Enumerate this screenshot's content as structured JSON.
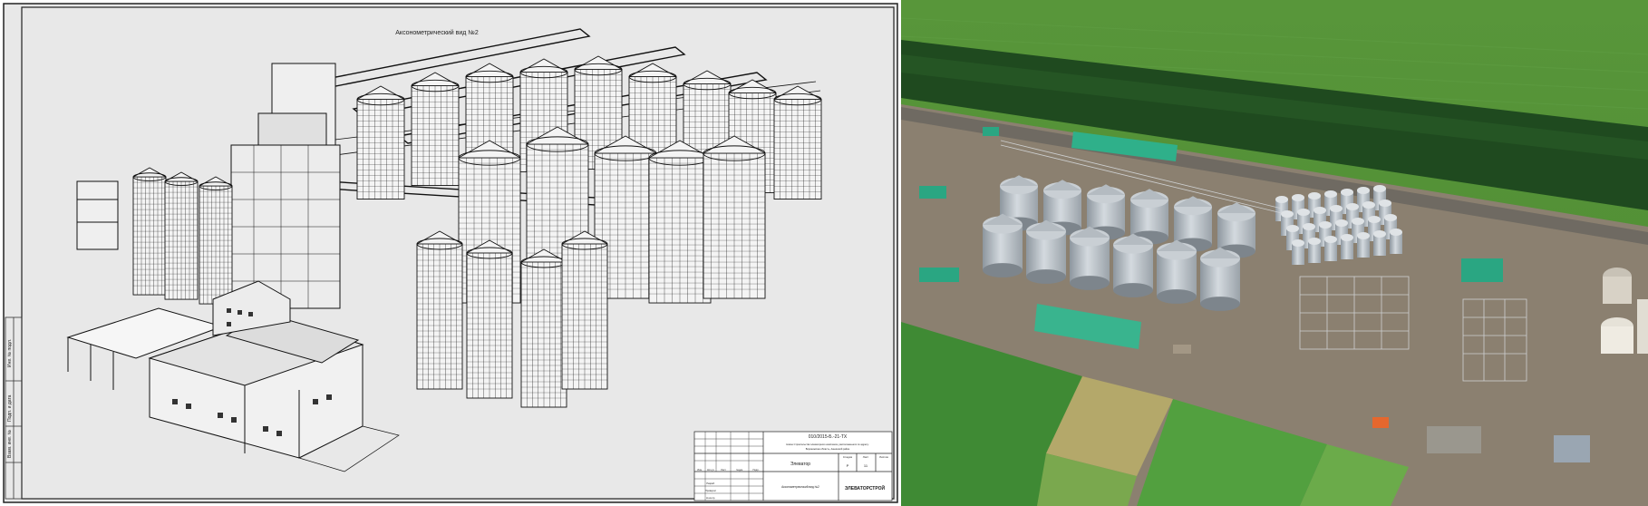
{
  "drawing": {
    "title": "Аксонометрический вид №2",
    "stamp": {
      "doc_code": "010/2015-Б.-21-ТХ",
      "project_line_1": "Новое Строительство элеваторного комплекса, расположенного по адресу:",
      "project_line_2": "Воронежская область, Аннинский район",
      "object": "Элеватор",
      "sheet_title": "Аксонометрический вид №2",
      "stage": "Р",
      "sheet": "11",
      "company": "ЭЛЕВАТОРСТРОЙ",
      "col_headers": [
        "Изм.",
        "Кол.уч",
        "Лист",
        "№док.",
        "Подп.",
        "Дата"
      ],
      "stage_headers": [
        "Стадия",
        "Лист",
        "Листов"
      ],
      "roles": [
        "Разраб.",
        "Проверил",
        "Н.контр."
      ]
    },
    "side_labels": [
      "Инв. № подл.",
      "Подп. и дата",
      "Взам. инв. №"
    ]
  },
  "photo": {
    "description_colors": {
      "field": "#5a9a3c",
      "trees": "#1f4a1f",
      "ground": "#8a7e6e",
      "silo": "#b9c0c6",
      "roof_green": "#2fb08a"
    }
  }
}
